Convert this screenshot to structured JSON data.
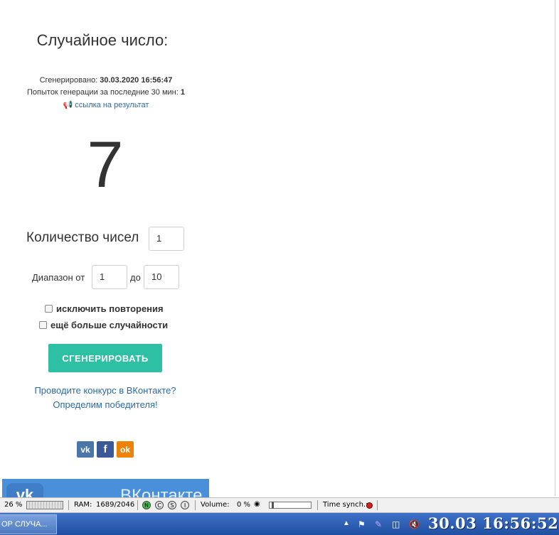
{
  "result": {
    "title": "Случайное число:",
    "generated_label": "Сгенерировано:",
    "generated_value": "30.03.2020 16:56:47",
    "attempts_label": "Попыток генерации за последние 30 мин:",
    "attempts_value": "1",
    "result_link": "ссылка на результат",
    "number": "7"
  },
  "form": {
    "count_label": "Количество чисел",
    "count_value": "1",
    "range_label": "Диапазон от",
    "range_from": "1",
    "range_to_label": "до",
    "range_to": "10",
    "exclude_repeats_label": "исключить повторения",
    "exclude_repeats_checked": false,
    "more_random_label": "ещё больше случайности",
    "more_random_checked": false,
    "generate_button": "СГЕНЕРИРОВАТЬ"
  },
  "promo": {
    "line1": "Проводите конкурс в ВКонтакте?",
    "line2": "Определим победителя!"
  },
  "social": {
    "vk": "vk",
    "fb": "f",
    "ok": "ok"
  },
  "banner": {
    "text": "ВКонтакте",
    "logo": "vk"
  },
  "statusbar": {
    "cpu": "26 %",
    "ram_label": "RAM:",
    "ram_value": "1689/2046",
    "net_n": "N",
    "net_c": "C",
    "net_s": "S",
    "net_i": "I",
    "volume_label": "Volume:",
    "volume_value": "0 %",
    "time_synch_label": "Time synch.:"
  },
  "taskbar": {
    "window_title": "ОР СЛУЧА...",
    "clock": "30.03  16:56:52"
  },
  "colors": {
    "accent_button": "#2ec0a5",
    "link": "#2a6aa8",
    "taskbar": "#1f4fa0"
  }
}
